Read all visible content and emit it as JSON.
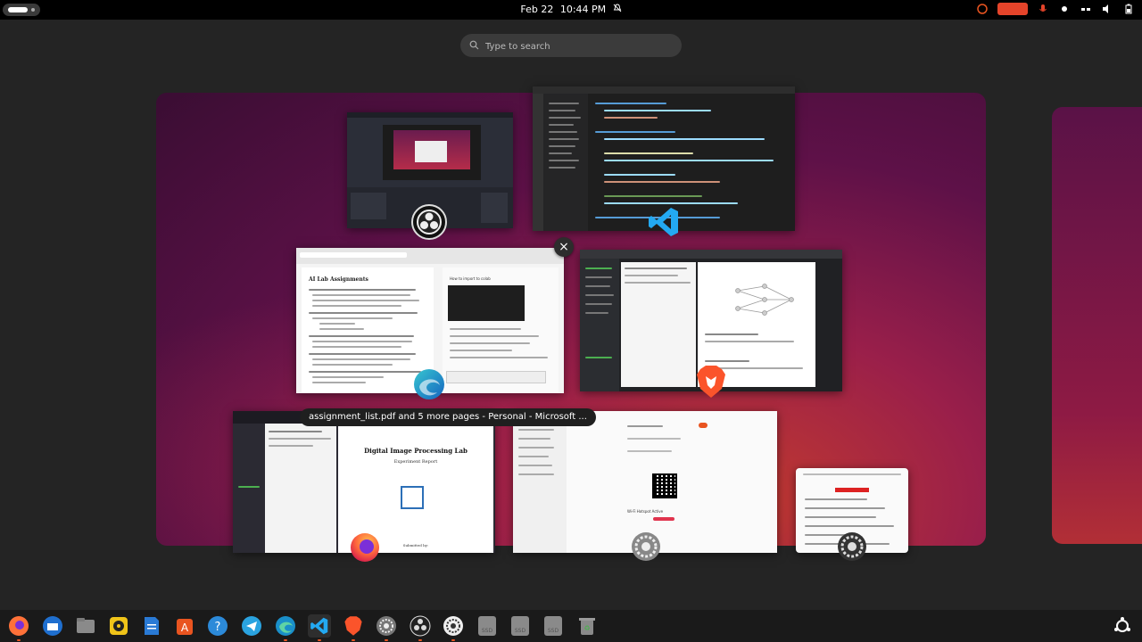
{
  "topbar": {
    "date": "Feb 22",
    "time": "10:44 PM"
  },
  "search": {
    "placeholder": "Type to search"
  },
  "tooltip": {
    "text": "assignment_list.pdf and 5 more pages - Personal - Microsoft ..."
  },
  "close_glyph": "×",
  "windows": {
    "pdf_doc": {
      "heading": "AI Lab Assignments",
      "section_title": "How to import to colab"
    },
    "dip_report": {
      "title": "Digital Image Processing Lab",
      "subtitle": "Experiment Report",
      "submitted_by": "Submitted by:"
    },
    "settings_wifi": {
      "label": "Wi-Fi Hotspot Active"
    }
  },
  "dock": {
    "items": [
      "firefox",
      "thunderbird",
      "files",
      "rhythmbox",
      "writer",
      "app-center",
      "help",
      "telegram",
      "edge",
      "vscode",
      "brave",
      "settings",
      "obs",
      "settings-dark",
      "ssd",
      "ssd",
      "ssd",
      "trash"
    ],
    "ssd_label": "SSD"
  },
  "colors": {
    "accent": "#e95420",
    "panel": "#000000",
    "workspace": "#9a1f4a"
  }
}
